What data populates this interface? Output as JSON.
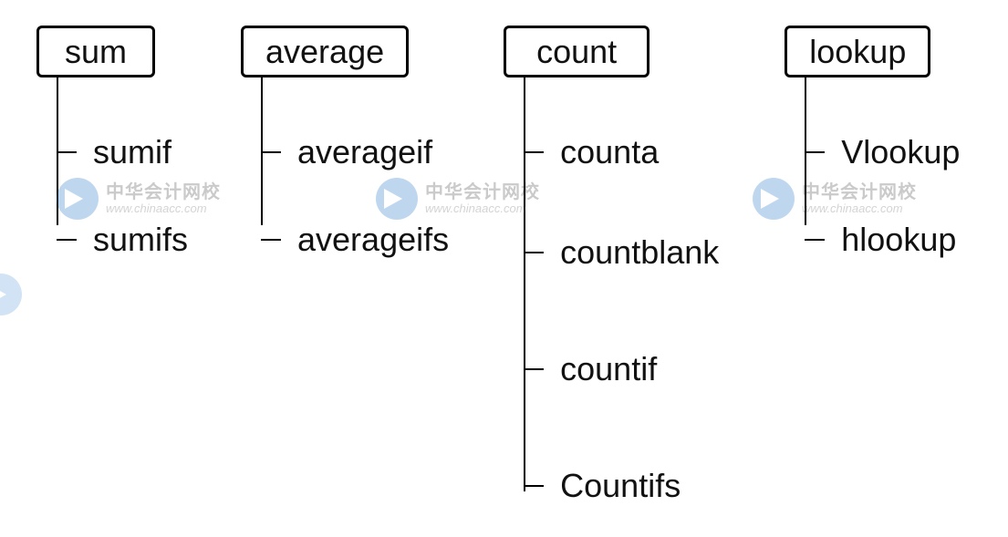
{
  "diagram": {
    "groups": [
      {
        "root": "sum",
        "children": [
          "sumif",
          "sumifs"
        ]
      },
      {
        "root": "average",
        "children": [
          "averageif",
          "averageifs"
        ]
      },
      {
        "root": "count",
        "children": [
          "counta",
          "countblank",
          "countif",
          "Countifs"
        ]
      },
      {
        "root": "lookup",
        "children": [
          "Vlookup",
          "hlookup"
        ]
      }
    ]
  },
  "watermark": {
    "line1": "中华会计网校",
    "line2": "www.chinaacc.com"
  }
}
